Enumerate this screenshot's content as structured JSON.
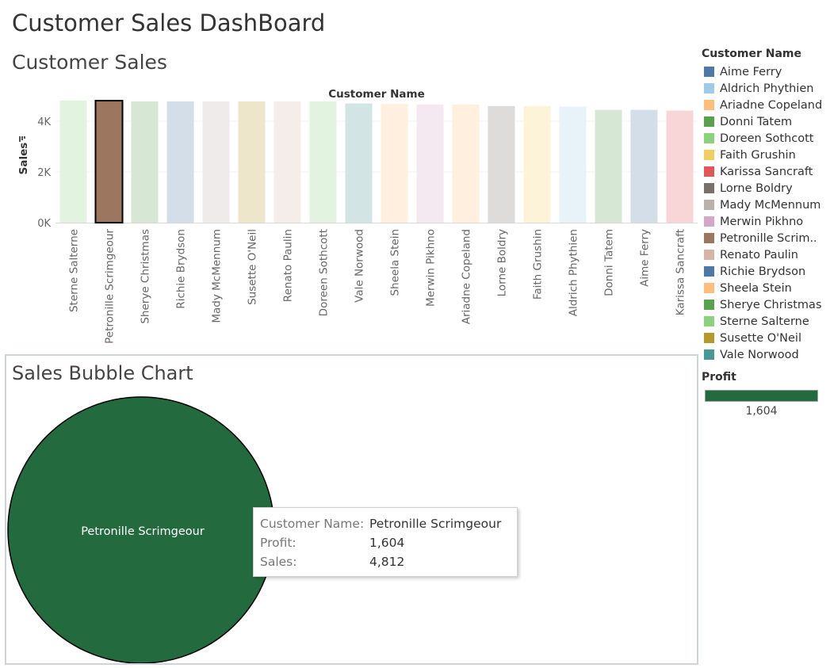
{
  "dashboard": {
    "title": "Customer Sales DashBoard"
  },
  "bar_panel": {
    "title": "Customer Sales"
  },
  "bubble_panel": {
    "title": "Sales Bubble Chart"
  },
  "legend": {
    "title": "Customer Name",
    "items": [
      {
        "label": "Aime Ferry",
        "color": "#4e79a7"
      },
      {
        "label": "Aldrich Phythien",
        "color": "#a0cbe8"
      },
      {
        "label": "Ariadne Copeland",
        "color": "#ffbe7d"
      },
      {
        "label": "Donni Tatem",
        "color": "#59a14f"
      },
      {
        "label": "Doreen Sothcott",
        "color": "#8cd17d"
      },
      {
        "label": "Faith Grushin",
        "color": "#f1ce63"
      },
      {
        "label": "Karissa Sancraft",
        "color": "#e15759"
      },
      {
        "label": "Lorne Boldry",
        "color": "#79706e"
      },
      {
        "label": "Mady McMennum",
        "color": "#bab0ac"
      },
      {
        "label": "Merwin Pikhno",
        "color": "#d4a6c8"
      },
      {
        "label": "Petronille Scrim..",
        "color": "#9d7660"
      },
      {
        "label": "Renato Paulin",
        "color": "#d7b5a6"
      },
      {
        "label": "Richie Brydson",
        "color": "#4e79a7"
      },
      {
        "label": "Sheela Stein",
        "color": "#ffbe7d"
      },
      {
        "label": "Sherye Christmas",
        "color": "#59a14f"
      },
      {
        "label": "Sterne Salterne",
        "color": "#8cd17d"
      },
      {
        "label": "Susette O'Neil",
        "color": "#b6992d"
      },
      {
        "label": "Vale Norwood",
        "color": "#499894"
      }
    ]
  },
  "profit_legend": {
    "title": "Profit",
    "value": "1,604",
    "color": "#236b3e"
  },
  "tooltip": {
    "rows": [
      {
        "key": "Customer Name:",
        "value": "Petronille Scrimgeour"
      },
      {
        "key": "Profit:",
        "value": "1,604"
      },
      {
        "key": "Sales:",
        "value": "4,812"
      }
    ]
  },
  "chart_data": [
    {
      "type": "bar",
      "title": "Customer Sales",
      "xlabel": "Customer Name",
      "ylabel": "Sales",
      "ylim": [
        0,
        5000
      ],
      "y_ticks": [
        0,
        2000,
        4000
      ],
      "y_tick_labels": [
        "0K",
        "2K",
        "4K"
      ],
      "sort": "descending",
      "highlighted": "Petronille Scrimgeour",
      "categories": [
        "Sterne Salterne",
        "Petronille Scrimgeour",
        "Sherye Christmas",
        "Richie Brydson",
        "Mady McMennum",
        "Susette O'Neil",
        "Renato Paulin",
        "Doreen Sothcott",
        "Vale Norwood",
        "Sheela Stein",
        "Merwin Pikhno",
        "Ariadne Copeland",
        "Lorne Boldry",
        "Faith Grushin",
        "Aldrich Phythien",
        "Donni Tatem",
        "Aime Ferry",
        "Karissa Sancraft"
      ],
      "values": [
        4820,
        4812,
        4780,
        4780,
        4780,
        4780,
        4780,
        4780,
        4700,
        4680,
        4660,
        4660,
        4600,
        4590,
        4580,
        4450,
        4450,
        4420
      ],
      "colors": [
        "#8cd17d",
        "#9d7660",
        "#59a14f",
        "#4e79a7",
        "#bab0ac",
        "#b6992d",
        "#d7b5a6",
        "#8cd17d",
        "#499894",
        "#ffbe7d",
        "#d4a6c8",
        "#ffbe7d",
        "#79706e",
        "#f1ce63",
        "#a0cbe8",
        "#59a14f",
        "#4e79a7",
        "#e15759"
      ],
      "grid": true
    },
    {
      "type": "scatter",
      "title": "Sales Bubble Chart",
      "series": [
        {
          "name": "Petronille Scrimgeour",
          "size": 4812,
          "profit": 1604,
          "color": "#236b3e"
        }
      ]
    }
  ]
}
